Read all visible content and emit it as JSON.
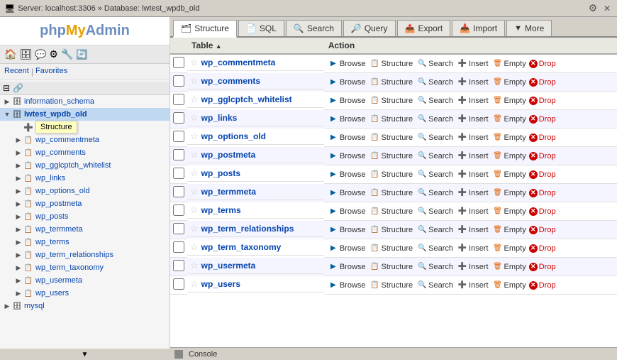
{
  "window": {
    "title": "Server: localhost:3306 » Database: lwtest_wpdb_old",
    "gear_icon": "⚙",
    "minimize_icon": "✕"
  },
  "logo": {
    "php": "php",
    "my": "My",
    "admin": "Admin"
  },
  "sidebar": {
    "recent_label": "Recent",
    "favorites_label": "Favorites",
    "databases": [
      {
        "name": "information_schema",
        "expanded": false,
        "indent": 0
      },
      {
        "name": "lwtest_wpdb_old",
        "expanded": true,
        "indent": 0,
        "selected": true
      },
      {
        "name": "New",
        "indent": 1,
        "is_new": true,
        "tooltip": "Structure"
      },
      {
        "name": "wp_commentmeta",
        "indent": 1
      },
      {
        "name": "wp_comments",
        "indent": 1
      },
      {
        "name": "wp_gglcptch_whitelist",
        "indent": 1
      },
      {
        "name": "wp_links",
        "indent": 1
      },
      {
        "name": "wp_options_old",
        "indent": 1
      },
      {
        "name": "wp_postmeta",
        "indent": 1
      },
      {
        "name": "wp_posts",
        "indent": 1
      },
      {
        "name": "wp_termmeta",
        "indent": 1
      },
      {
        "name": "wp_terms",
        "indent": 1
      },
      {
        "name": "wp_term_relationships",
        "indent": 1
      },
      {
        "name": "wp_term_taxonomy",
        "indent": 1
      },
      {
        "name": "wp_usermeta",
        "indent": 1
      },
      {
        "name": "wp_users",
        "indent": 1
      },
      {
        "name": "mysql",
        "expanded": false,
        "indent": 0
      }
    ]
  },
  "tabs": [
    {
      "id": "structure",
      "label": "Structure",
      "active": true,
      "icon": "🗂"
    },
    {
      "id": "sql",
      "label": "SQL",
      "active": false,
      "icon": "📄"
    },
    {
      "id": "search",
      "label": "Search",
      "active": false,
      "icon": "🔍"
    },
    {
      "id": "query",
      "label": "Query",
      "active": false,
      "icon": "🔎"
    },
    {
      "id": "export",
      "label": "Export",
      "active": false,
      "icon": "📤"
    },
    {
      "id": "import",
      "label": "Import",
      "active": false,
      "icon": "📥"
    },
    {
      "id": "more",
      "label": "More",
      "active": false,
      "icon": "▼"
    }
  ],
  "table_header": {
    "checkbox_col": "",
    "table_col": "Table",
    "action_col": "Action"
  },
  "tables": [
    {
      "name": "wp_commentmeta"
    },
    {
      "name": "wp_comments"
    },
    {
      "name": "wp_gglcptch_whitelist"
    },
    {
      "name": "wp_links"
    },
    {
      "name": "wp_options_old"
    },
    {
      "name": "wp_postmeta"
    },
    {
      "name": "wp_posts"
    },
    {
      "name": "wp_termmeta"
    },
    {
      "name": "wp_terms"
    },
    {
      "name": "wp_term_relationships"
    },
    {
      "name": "wp_term_taxonomy"
    },
    {
      "name": "wp_usermeta"
    },
    {
      "name": "wp_users"
    }
  ],
  "actions": {
    "browse": "Browse",
    "structure": "Structure",
    "search": "Search",
    "insert": "Insert",
    "empty": "Empty",
    "drop": "Drop"
  },
  "console": {
    "label": "Console"
  }
}
